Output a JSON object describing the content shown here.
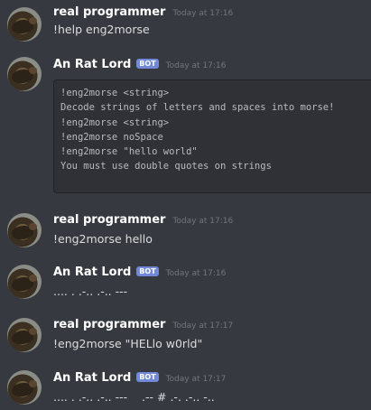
{
  "messages": [
    {
      "username": "real programmer",
      "timestamp": "Today at 17:16",
      "text": "!help eng2morse"
    },
    {
      "username": "An Rat Lord",
      "bot_badge": "BOT",
      "timestamp": "Today at 17:16",
      "code_lines": [
        "!eng2morse <string>",
        "",
        "Decode strings of letters and spaces into morse!",
        "!eng2morse <string>",
        "!eng2morse noSpace",
        "!eng2morse \"hello world\"",
        "You must use double quotes on strings"
      ]
    },
    {
      "username": "real programmer",
      "timestamp": "Today at 17:16",
      "text": "!eng2morse hello"
    },
    {
      "username": "An Rat Lord",
      "bot_badge": "BOT",
      "timestamp": "Today at 17:16",
      "text": ".... . .-.. .-.. ---"
    },
    {
      "username": "real programmer",
      "timestamp": "Today at 17:17",
      "text": "!eng2morse \"HELlo w0rld\""
    },
    {
      "username": "An Rat Lord",
      "bot_badge": "BOT",
      "timestamp": "Today at 17:17",
      "text": ".... . .-.. .-.. ---    .-- # .-. .-.. -.."
    }
  ]
}
